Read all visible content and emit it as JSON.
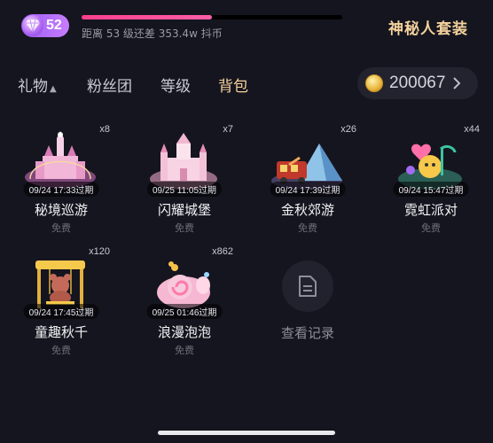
{
  "header": {
    "level": "52",
    "progress_fraction": 0.5,
    "level_text": "距离 53 级还差 353.4w 抖币",
    "mystery_label": "神秘人套装",
    "colors": {
      "badge": "#b26bf2",
      "progress": "#ff4f9a",
      "gold_text": "#f3d19c"
    }
  },
  "tabs": [
    {
      "label": "礼物",
      "icon": "sort-updown-icon"
    },
    {
      "label": "粉丝团"
    },
    {
      "label": "等级"
    },
    {
      "label": "背包",
      "active": true
    }
  ],
  "coins": {
    "amount": "200067",
    "icon": "coin-icon"
  },
  "items": [
    {
      "name": "秘境巡游",
      "count": "x8",
      "expire": "09/24 17:33过期",
      "price": "免费",
      "icon": "pink-castle-icon"
    },
    {
      "name": "闪耀城堡",
      "count": "x7",
      "expire": "09/25 11:05过期",
      "price": "免费",
      "icon": "castle-icon"
    },
    {
      "name": "金秋郊游",
      "count": "x26",
      "expire": "09/24 17:39过期",
      "price": "免费",
      "icon": "autumn-picnic-icon"
    },
    {
      "name": "霓虹派对",
      "count": "x44",
      "expire": "09/24 15:47过期",
      "price": "免费",
      "icon": "neon-party-icon"
    },
    {
      "name": "童趣秋千",
      "count": "x120",
      "expire": "09/24 17:45过期",
      "price": "免费",
      "icon": "bear-swing-icon"
    },
    {
      "name": "浪漫泡泡",
      "count": "x862",
      "expire": "09/25 01:46过期",
      "price": "免费",
      "icon": "bubble-snail-icon"
    }
  ],
  "record": {
    "label": "查看记录",
    "icon": "document-icon"
  }
}
